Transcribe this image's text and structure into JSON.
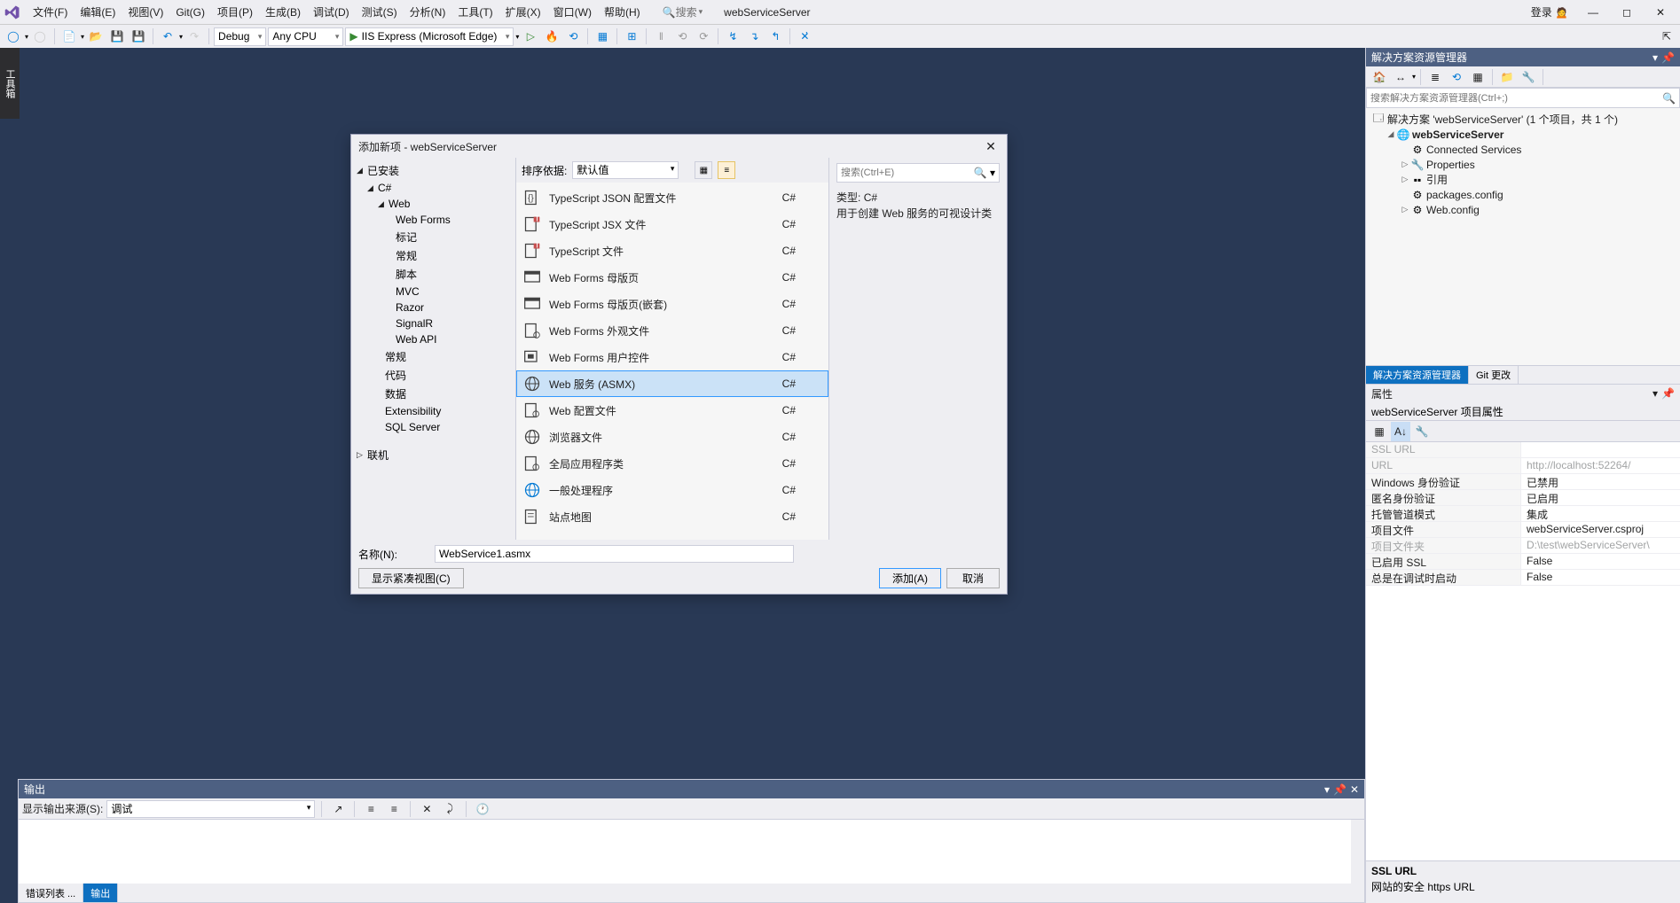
{
  "menu": {
    "items": [
      "文件(F)",
      "编辑(E)",
      "视图(V)",
      "Git(G)",
      "项目(P)",
      "生成(B)",
      "调试(D)",
      "测试(S)",
      "分析(N)",
      "工具(T)",
      "扩展(X)",
      "窗口(W)",
      "帮助(H)"
    ],
    "search_placeholder": "搜索",
    "project": "webServiceServer",
    "login": "登录"
  },
  "toolbar": {
    "config": "Debug",
    "platform": "Any CPU",
    "run_target": "IIS Express (Microsoft Edge)"
  },
  "left_tab": "工具箱",
  "solution": {
    "title": "解决方案资源管理器",
    "search_placeholder": "搜索解决方案资源管理器(Ctrl+;)",
    "root": "解决方案 'webServiceServer' (1 个项目，共 1 个)",
    "project": "webServiceServer",
    "items": [
      "Connected Services",
      "Properties",
      "引用",
      "packages.config",
      "Web.config"
    ],
    "tabs": [
      "解决方案资源管理器",
      "Git 更改"
    ]
  },
  "properties": {
    "title": "属性",
    "target": "webServiceServer 项目属性",
    "rows": [
      {
        "k": "SSL URL",
        "v": "",
        "disabled": true
      },
      {
        "k": "URL",
        "v": "http://localhost:52264/",
        "disabled": true
      },
      {
        "k": "Windows 身份验证",
        "v": "已禁用"
      },
      {
        "k": "匿名身份验证",
        "v": "已启用"
      },
      {
        "k": "托管管道模式",
        "v": "集成"
      },
      {
        "k": "项目文件",
        "v": "webServiceServer.csproj"
      },
      {
        "k": "项目文件夹",
        "v": "D:\\test\\webServiceServer\\",
        "disabled": true
      },
      {
        "k": "已启用 SSL",
        "v": "False"
      },
      {
        "k": "总是在调试时启动",
        "v": "False"
      }
    ],
    "desc_title": "SSL URL",
    "desc": "网站的安全 https URL"
  },
  "output": {
    "title": "输出",
    "source_label": "显示输出来源(S):",
    "source": "调试",
    "tabs": [
      "错误列表 ...",
      "输出"
    ]
  },
  "dialog": {
    "title": "添加新项 - webServiceServer",
    "left": {
      "installed": "已安装",
      "csharp": "C#",
      "web": "Web",
      "web_children": [
        "Web Forms",
        "标记",
        "常规",
        "脚本",
        "MVC",
        "Razor",
        "SignalR",
        "Web API"
      ],
      "after": [
        "常规",
        "代码",
        "数据",
        "Extensibility",
        "SQL Server"
      ],
      "online": "联机"
    },
    "mid": {
      "sort_label": "排序依据:",
      "sort_value": "默认值",
      "templates": [
        {
          "name": "TypeScript JSON 配置文件",
          "lang": "C#",
          "icon": "json"
        },
        {
          "name": "TypeScript JSX 文件",
          "lang": "C#",
          "icon": "ts"
        },
        {
          "name": "TypeScript 文件",
          "lang": "C#",
          "icon": "ts"
        },
        {
          "name": "Web Forms 母版页",
          "lang": "C#",
          "icon": "master"
        },
        {
          "name": "Web Forms 母版页(嵌套)",
          "lang": "C#",
          "icon": "master"
        },
        {
          "name": "Web Forms 外观文件",
          "lang": "C#",
          "icon": "skin"
        },
        {
          "name": "Web Forms 用户控件",
          "lang": "C#",
          "icon": "control"
        },
        {
          "name": "Web 服务 (ASMX)",
          "lang": "C#",
          "icon": "globe",
          "selected": true
        },
        {
          "name": "Web 配置文件",
          "lang": "C#",
          "icon": "config"
        },
        {
          "name": "浏览器文件",
          "lang": "C#",
          "icon": "globe"
        },
        {
          "name": "全局应用程序类",
          "lang": "C#",
          "icon": "global"
        },
        {
          "name": "一般处理程序",
          "lang": "C#",
          "icon": "handler"
        },
        {
          "name": "站点地图",
          "lang": "C#",
          "icon": "sitemap"
        }
      ]
    },
    "right": {
      "search_placeholder": "搜索(Ctrl+E)",
      "type_label": "类型:",
      "type_value": "C#",
      "desc": "用于创建 Web 服务的可视设计类"
    },
    "name_label": "名称(N):",
    "name_value": "WebService1.asmx",
    "compact_btn": "显示紧凑视图(C)",
    "add_btn": "添加(A)",
    "cancel_btn": "取消"
  }
}
